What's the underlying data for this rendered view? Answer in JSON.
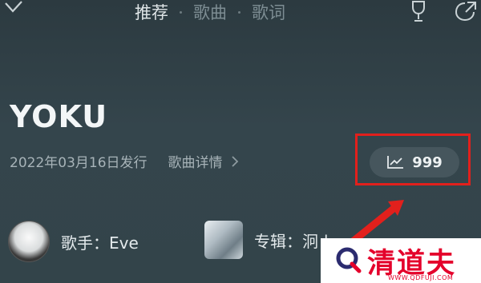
{
  "tabs": [
    {
      "label": "推荐",
      "active": true
    },
    {
      "label": "歌曲",
      "active": false
    },
    {
      "label": "歌词",
      "active": false
    }
  ],
  "song": {
    "title": "YOKU",
    "release": "2022年03月16日发行",
    "detail_label": "歌曲详情",
    "play_count": "999"
  },
  "artist": {
    "label": "歌手：Eve"
  },
  "album": {
    "label": "专辑：泂 |"
  },
  "watermark": {
    "brand": "清道夫",
    "url": "WWW.QDFUJI.COM"
  },
  "colors": {
    "highlight": "#e2201c",
    "watermark": "#e4002b",
    "accent_bg": "#46565d"
  },
  "icons": [
    "chevron-down-icon",
    "trophy-icon",
    "share-icon",
    "trend-chart-icon",
    "chevron-right-icon",
    "arrow-icon",
    "logo-icon"
  ]
}
